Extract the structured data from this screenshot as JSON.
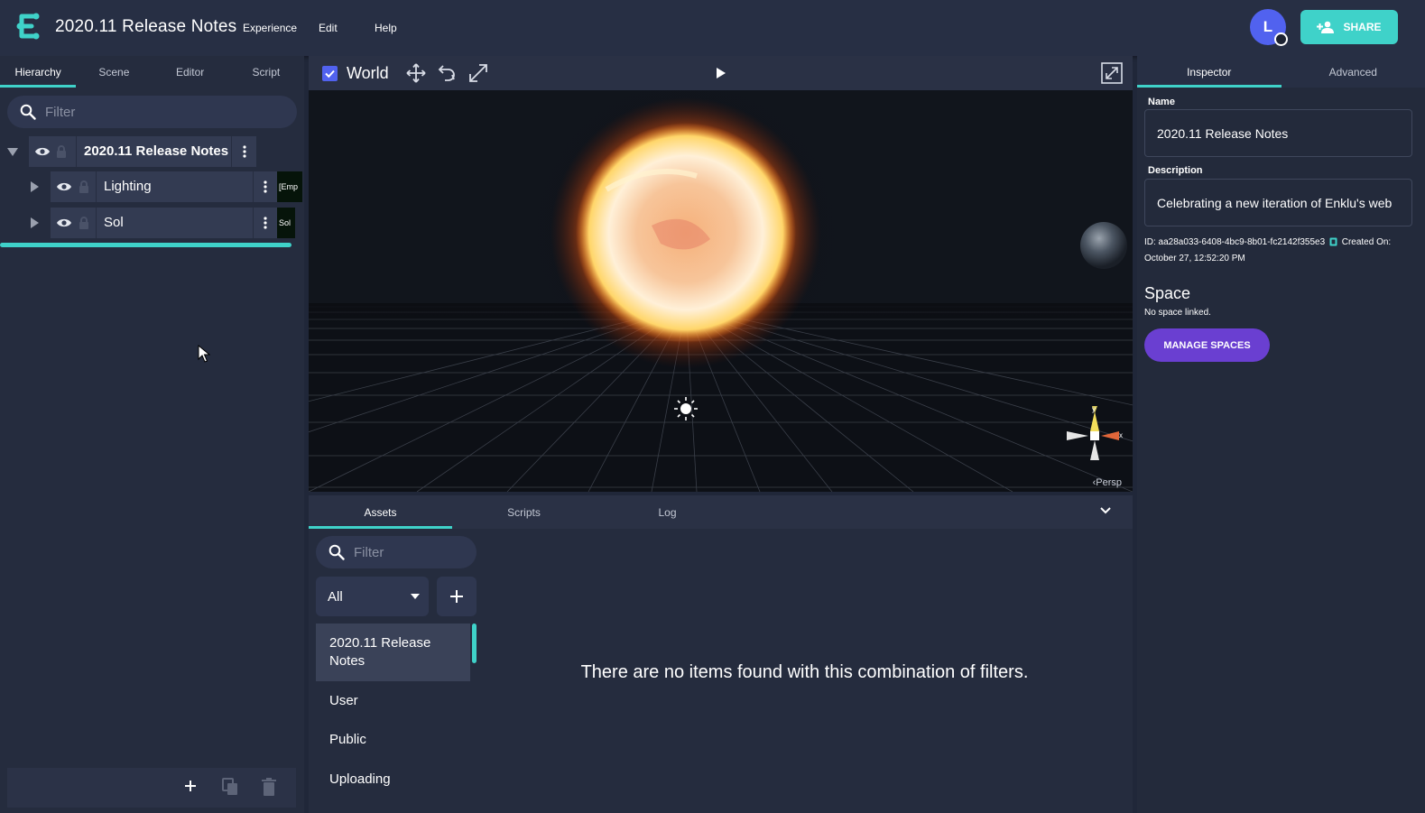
{
  "app": {
    "title": "2020.11 Release Notes",
    "menu": [
      "Experience",
      "Edit",
      "Help"
    ],
    "avatar_initial": "L",
    "share_label": "SHARE",
    "accent_color": "#3fd2c9",
    "primary_color": "#5162ef"
  },
  "left_panel": {
    "tabs": [
      "Hierarchy",
      "Scene",
      "Editor",
      "Script"
    ],
    "active_tab": "Hierarchy",
    "filter_placeholder": "Filter",
    "tree": {
      "root": {
        "label": "2020.11 Release Notes"
      },
      "children": [
        {
          "label": "Lighting",
          "preview": "[Emp"
        },
        {
          "label": "Sol",
          "preview": "Sol"
        }
      ]
    }
  },
  "viewport": {
    "world_label": "World",
    "world_checked": true,
    "camera_mode": "Persp",
    "gizmo_axes": [
      "y",
      "x"
    ]
  },
  "bottom_panel": {
    "tabs": [
      "Assets",
      "Scripts",
      "Log"
    ],
    "active_tab": "Assets",
    "filter_placeholder": "Filter",
    "select_value": "All",
    "categories": [
      "2020.11 Release Notes",
      "User",
      "Public",
      "Uploading"
    ],
    "active_category": "2020.11 Release Notes",
    "empty_message": "There are no items found with this combination of filters."
  },
  "inspector": {
    "tabs": [
      "Inspector",
      "Advanced"
    ],
    "active_tab": "Inspector",
    "name_label": "Name",
    "name_value": "2020.11 Release Notes",
    "description_label": "Description",
    "description_value": "Celebrating a new iteration of Enklu's web",
    "id_text": "ID: aa28a033-6408-4bc9-8b01-fc2142f355e3",
    "created_label": "Created On:",
    "created_date": "October 27, 12:52:20 PM",
    "space_title": "Space",
    "space_subtitle": "No space linked.",
    "manage_spaces_label": "MANAGE SPACES"
  }
}
